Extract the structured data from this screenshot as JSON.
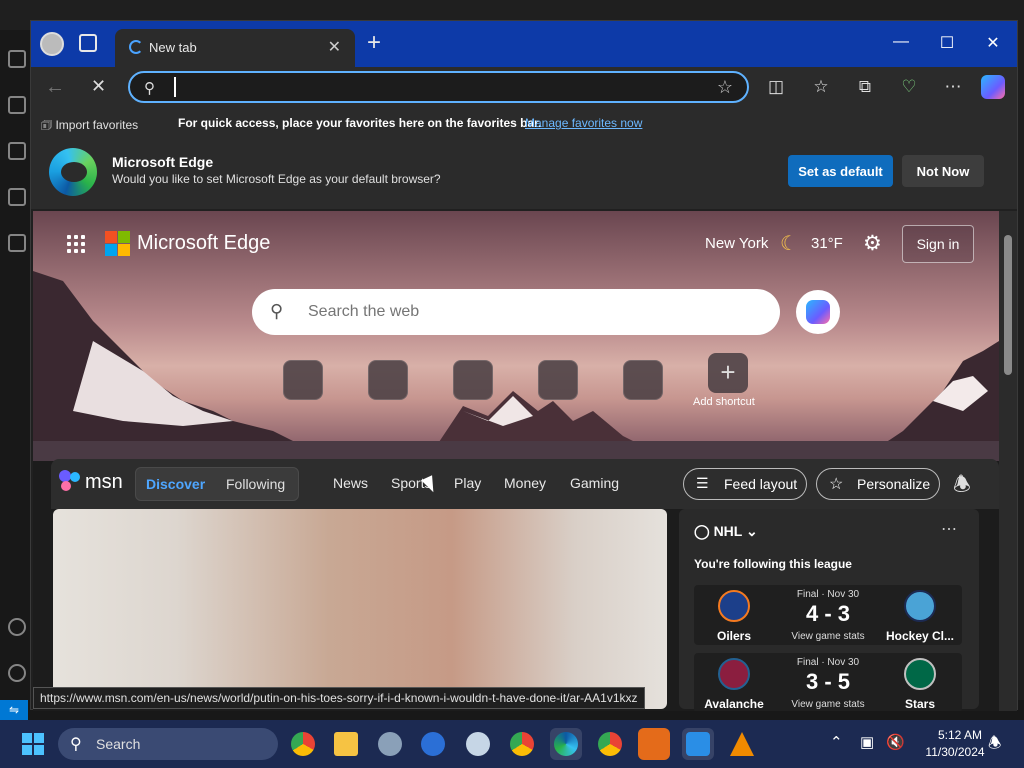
{
  "browser": {
    "tab_title": "New tab",
    "address_value": "",
    "favorites_bar": {
      "import_label": "Import favorites",
      "message": "For quick access, place your favorites here on the favorites bar.",
      "manage_link": "Manage favorites now"
    },
    "infobar": {
      "title": "Microsoft Edge",
      "question": "Would you like to set Microsoft Edge as your default browser?",
      "set_default_label": "Set as default",
      "not_now_label": "Not Now"
    },
    "status_url": "https://www.msn.com/en-us/news/world/putin-on-his-toes-sorry-if-i-d-known-i-wouldn-t-have-done-it/ar-AA1v1kxz"
  },
  "ntp": {
    "brand": "Microsoft Edge",
    "weather": {
      "city": "New York",
      "temp": "31°F"
    },
    "sign_in_label": "Sign in",
    "search_placeholder": "Search the web",
    "add_shortcut_label": "Add shortcut"
  },
  "msn": {
    "logo_text": "msn",
    "tabs": [
      "Discover",
      "Following"
    ],
    "nav": [
      "News",
      "Sports",
      "Play",
      "Money",
      "Gaming"
    ],
    "feed_layout_label": "Feed layout",
    "personalize_label": "Personalize"
  },
  "nhl": {
    "league": "NHL",
    "following_text": "You're following this league",
    "games": [
      {
        "status": "Final · Nov 30",
        "score": "4 - 3",
        "stats": "View game stats",
        "home": "Oilers",
        "away": "Hockey Cl..."
      },
      {
        "status": "Final · Nov 30",
        "score": "3 - 5",
        "stats": "View game stats",
        "home": "Avalanche",
        "away": "Stars"
      }
    ]
  },
  "taskbar": {
    "search_label": "Search",
    "time": "5:12 AM",
    "date": "11/30/2024"
  },
  "colors": {
    "title_bar": "#0d3aa8",
    "accent": "#0f6cbd",
    "link": "#6cb8ff",
    "taskbar": "#1c2a52"
  },
  "icons": [
    "search-icon",
    "star-icon",
    "split-screen-icon",
    "favorites-icon",
    "collections-icon",
    "health-icon",
    "more-icon",
    "copilot-icon",
    "gear-icon",
    "bell-icon",
    "moon-icon"
  ]
}
